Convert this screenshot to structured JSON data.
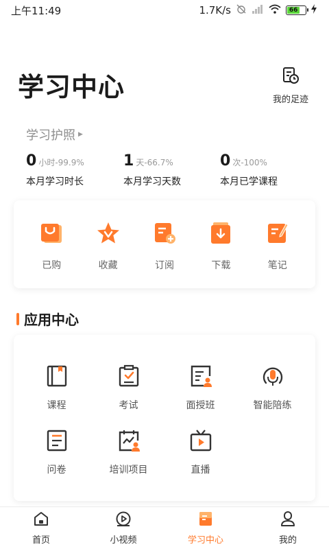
{
  "status_bar": {
    "time": "上午11:49",
    "network_speed": "1.7K/s",
    "battery": "66"
  },
  "header": {
    "title": "学习中心",
    "footprint_label": "我的足迹"
  },
  "passport": {
    "title": "学习护照",
    "stats": [
      {
        "value": "0",
        "unit": "小时-99.9%",
        "label": "本月学习时长"
      },
      {
        "value": "1",
        "unit": "天-66.7%",
        "label": "本月学习天数"
      },
      {
        "value": "0",
        "unit": "次-100%",
        "label": "本月已学课程"
      }
    ]
  },
  "quick_actions": [
    {
      "label": "已购",
      "icon": "bag-icon"
    },
    {
      "label": "收藏",
      "icon": "star-icon"
    },
    {
      "label": "订阅",
      "icon": "subscribe-icon"
    },
    {
      "label": "下载",
      "icon": "download-icon"
    },
    {
      "label": "笔记",
      "icon": "note-icon"
    }
  ],
  "app_center": {
    "title": "应用中心",
    "items": [
      {
        "label": "课程",
        "icon": "book-icon"
      },
      {
        "label": "考试",
        "icon": "exam-icon"
      },
      {
        "label": "面授班",
        "icon": "class-icon"
      },
      {
        "label": "智能陪练",
        "icon": "microphone-icon"
      },
      {
        "label": "问卷",
        "icon": "survey-icon"
      },
      {
        "label": "培训项目",
        "icon": "training-icon"
      },
      {
        "label": "直播",
        "icon": "live-icon"
      }
    ]
  },
  "tabbar": {
    "items": [
      {
        "label": "首页",
        "icon": "home-icon"
      },
      {
        "label": "小视频",
        "icon": "video-icon"
      },
      {
        "label": "学习中心",
        "icon": "study-icon"
      },
      {
        "label": "我的",
        "icon": "profile-icon"
      }
    ],
    "active_index": 2
  },
  "colors": {
    "accent": "#ff7a2c",
    "accent_light": "#ffb36a"
  }
}
